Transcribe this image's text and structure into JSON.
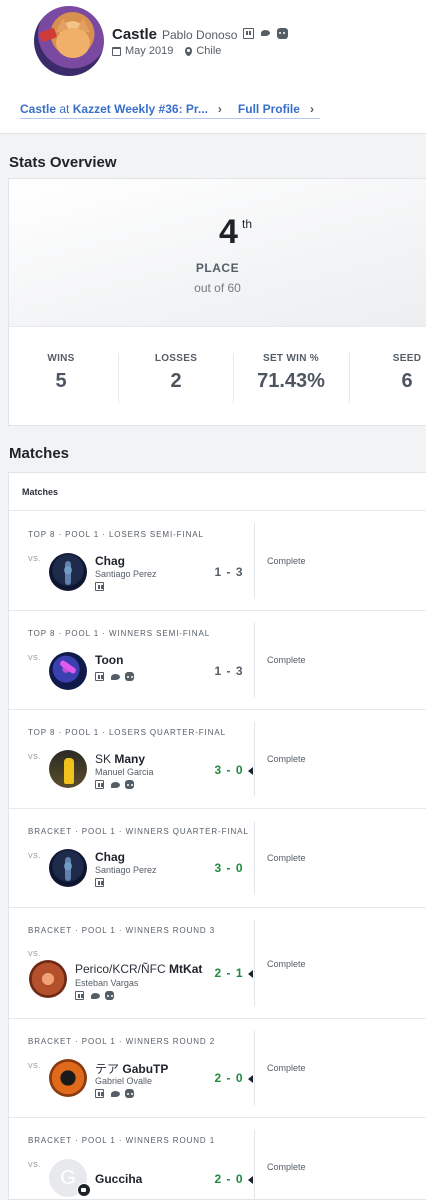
{
  "profile": {
    "gamer_tag": "Castle",
    "real_name": "Pablo Donoso",
    "joined": "May 2019",
    "location": "Chile",
    "socials": [
      "twitch-icon",
      "twitter-icon",
      "discord-icon"
    ],
    "event_link": {
      "gamer_tag": "Castle",
      "at_word": "at",
      "event_name": "Kazzet Weekly #36: Pr...",
      "chevron": "›"
    },
    "full_profile_label": "Full Profile",
    "full_profile_chevron": "›"
  },
  "stats_overview": {
    "title": "Stats Overview",
    "placement": "4",
    "placement_suffix": "th",
    "place_label": "PLACE",
    "out_of": "out of 60",
    "items": [
      {
        "label": "WINS",
        "value": "5"
      },
      {
        "label": "LOSSES",
        "value": "2"
      },
      {
        "label": "SET WIN %",
        "value": "71.43%"
      },
      {
        "label": "SEED",
        "value": "6"
      }
    ]
  },
  "matches": {
    "title": "Matches",
    "header": "Matches",
    "vs_label": "VS.",
    "rows": [
      {
        "round": "TOP 8 · POOL 1 · LOSERS SEMI-FINAL",
        "prefix": "",
        "tag": "Chag",
        "real_name": "Santiago Perez",
        "socials": [
          "twitch-icon"
        ],
        "score": "1 - 3",
        "result": "loss",
        "status": "Complete"
      },
      {
        "round": "TOP 8 · POOL 1 · WINNERS SEMI-FINAL",
        "prefix": "",
        "tag": "Toon",
        "real_name": "",
        "socials": [
          "twitch-icon",
          "twitter-icon",
          "discord-icon"
        ],
        "score": "1 - 3",
        "result": "loss",
        "status": "Complete"
      },
      {
        "round": "TOP 8 · POOL 1 · LOSERS QUARTER-FINAL",
        "prefix": "SK",
        "tag": "Many",
        "real_name": "Manuel Garcia",
        "socials": [
          "twitch-icon",
          "twitter-icon",
          "discord-icon"
        ],
        "score": "3 - 0",
        "result": "win",
        "status": "Complete"
      },
      {
        "round": "BRACKET · POOL 1 · WINNERS QUARTER-FINAL",
        "prefix": "",
        "tag": "Chag",
        "real_name": "Santiago Perez",
        "socials": [
          "twitch-icon"
        ],
        "score": "3 - 0",
        "result": "win",
        "status": "Complete"
      },
      {
        "round": "BRACKET · POOL 1 · WINNERS ROUND 3",
        "prefix": "Perico/KCR/ÑFC",
        "tag": "MtKat",
        "real_name": "Esteban Vargas",
        "socials": [
          "twitch-icon",
          "twitter-icon",
          "discord-icon"
        ],
        "score": "2 - 1",
        "result": "win",
        "status": "Complete"
      },
      {
        "round": "BRACKET · POOL 1 · WINNERS ROUND 2",
        "prefix": "テア",
        "tag": "GabuTP",
        "real_name": "Gabriel Ovalle",
        "socials": [
          "twitch-icon",
          "twitter-icon",
          "discord-icon"
        ],
        "score": "2 - 0",
        "result": "win",
        "status": "Complete"
      },
      {
        "round": "BRACKET · POOL 1 · WINNERS ROUND 1",
        "prefix": "",
        "tag": "Gucciha",
        "real_name": "",
        "socials": [],
        "avatar_letter": "G",
        "score": "2 - 0",
        "result": "win",
        "status": "Complete"
      }
    ]
  },
  "colors": {
    "link": "#3a6fc9",
    "win": "#1f8a3e",
    "loss": "#555e67",
    "text": "#1d2329",
    "background": "#f2f3f5"
  }
}
